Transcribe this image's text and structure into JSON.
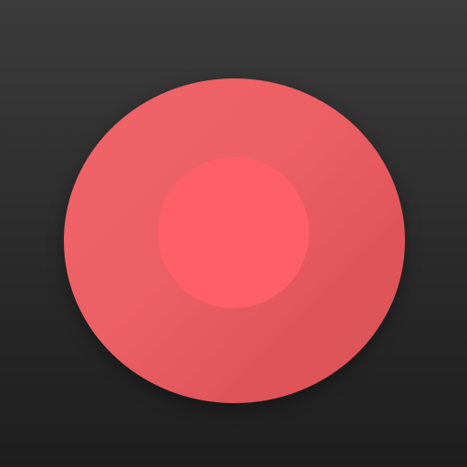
{
  "icon": {
    "name": "record-icon",
    "colors": {
      "background_top": "#3c3b3c",
      "background_bottom": "#1f1e1f",
      "disc": "#ec5f65",
      "center": "#fd5f66"
    }
  }
}
